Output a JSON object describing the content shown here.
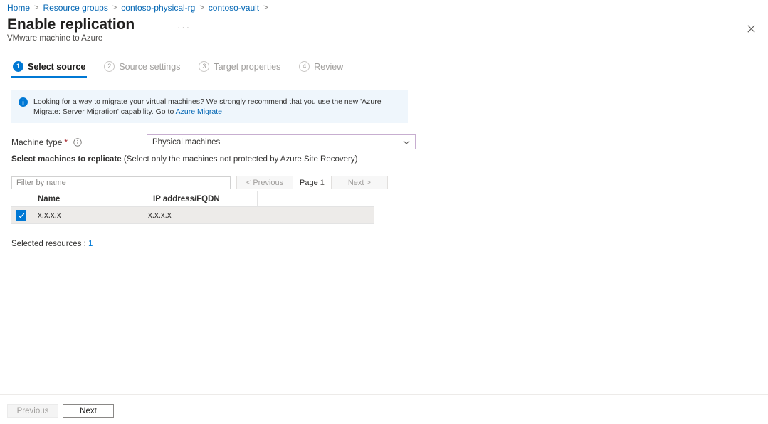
{
  "breadcrumb": {
    "separator": ">",
    "items": [
      {
        "label": "Home"
      },
      {
        "label": "Resource groups"
      },
      {
        "label": "contoso-physical-rg"
      },
      {
        "label": "contoso-vault"
      }
    ],
    "trailing_separator": ">"
  },
  "header": {
    "title": "Enable replication",
    "subtitle": "VMware machine to Azure",
    "more_menu": "···",
    "close_label": "Close"
  },
  "steps": [
    {
      "num": "1",
      "label": "Select source",
      "state": "active"
    },
    {
      "num": "2",
      "label": "Source settings",
      "state": "inactive"
    },
    {
      "num": "3",
      "label": "Target properties",
      "state": "inactive"
    },
    {
      "num": "4",
      "label": "Review",
      "state": "inactive"
    }
  ],
  "info_banner": {
    "icon": "info-icon",
    "text_before_link": "Looking for a way to migrate your virtual machines? We strongly recommend that you use the new 'Azure Migrate: Server Migration' capability. Go to ",
    "link_text": "Azure Migrate",
    "background": "#eff6fc",
    "icon_color": "#0078d4"
  },
  "machine_type": {
    "label": "Machine type",
    "required_marker": "*",
    "info_tooltip": "info-icon",
    "selected_value": "Physical machines",
    "options": [
      "Physical machines"
    ],
    "border_color": "#c7aed0"
  },
  "select_machines": {
    "heading_bold": "Select machines to replicate",
    "heading_note": " (Select only the machines not protected by Azure Site Recovery)"
  },
  "toolbar": {
    "filter_placeholder": "Filter by name",
    "filter_value": "",
    "previous_label": "< Previous",
    "page_label": "Page",
    "page_number": "1",
    "next_label": "Next >"
  },
  "table": {
    "columns": [
      "Name",
      "IP address/FQDN"
    ],
    "rows": [
      {
        "checked": true,
        "name": "x.x.x.x",
        "ip": "x.x.x.x"
      }
    ]
  },
  "selected_resources": {
    "label": "Selected resources :",
    "count": "1",
    "count_color": "#0078d4"
  },
  "footer": {
    "previous_label": "Previous",
    "previous_enabled": false,
    "next_label": "Next",
    "next_enabled": true
  },
  "colors": {
    "accent": "#0078d4",
    "link": "#0065b3",
    "required": "#a4262c",
    "row_selected_bg": "#edebe9"
  }
}
